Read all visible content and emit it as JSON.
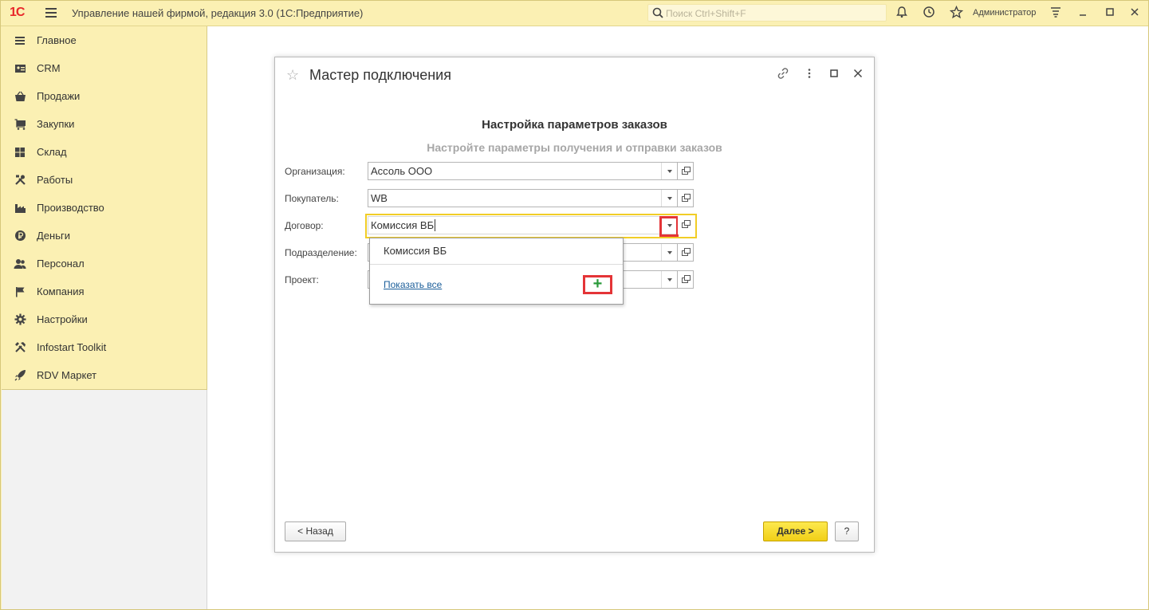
{
  "titlebar": {
    "logo": "1С",
    "app_title": "Управление нашей фирмой, редакция 3.0  (1С:Предприятие)",
    "search_placeholder": "Поиск Ctrl+Shift+F",
    "user": "Администратор"
  },
  "sidebar": {
    "items": [
      {
        "label": "Главное",
        "icon": "menu-lines-icon"
      },
      {
        "label": "CRM",
        "icon": "contacts-icon"
      },
      {
        "label": "Продажи",
        "icon": "basket-icon"
      },
      {
        "label": "Закупки",
        "icon": "cart-icon"
      },
      {
        "label": "Склад",
        "icon": "warehouse-icon"
      },
      {
        "label": "Работы",
        "icon": "tools-icon"
      },
      {
        "label": "Производство",
        "icon": "factory-icon"
      },
      {
        "label": "Деньги",
        "icon": "ruble-icon"
      },
      {
        "label": "Персонал",
        "icon": "people-icon"
      },
      {
        "label": "Компания",
        "icon": "flag-icon"
      },
      {
        "label": "Настройки",
        "icon": "gear-icon"
      },
      {
        "label": "Infostart Toolkit",
        "icon": "wrench-icon"
      },
      {
        "label": "RDV Маркет",
        "icon": "rocket-icon"
      }
    ]
  },
  "dialog": {
    "title": "Мастер подключения",
    "heading": "Настройка параметров заказов",
    "subheading": "Настройте параметры получения и отправки заказов",
    "fields": [
      {
        "label": "Организация:",
        "value": "Ассоль ООО"
      },
      {
        "label": "Покупатель:",
        "value": "WB"
      },
      {
        "label": "Договор:",
        "value": "Комиссия ВБ"
      },
      {
        "label": "Подразделение:",
        "value": ""
      },
      {
        "label": "Проект:",
        "value": ""
      }
    ],
    "dropdown": {
      "item": "Комиссия ВБ",
      "show_all": "Показать все",
      "add_symbol": "+"
    },
    "back_button": "< Назад",
    "next_button": "Далее >",
    "help_button": "?"
  }
}
